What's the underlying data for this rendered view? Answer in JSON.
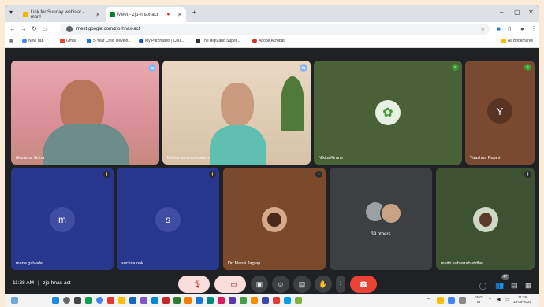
{
  "browser": {
    "tabs": [
      {
        "title": "Link for Sunday webinar - maril",
        "active": false
      },
      {
        "title": "Meet - zjo-hnax-act",
        "active": true
      }
    ],
    "url": "meet.google.com/zjo-hnax-act",
    "bookmarks": [
      "New Tab",
      "Gmail",
      "5-Year Child Develo...",
      "My Purchases | Cou...",
      "The Big6 and Super...",
      "Adobe Acrobat"
    ],
    "all_bookmarks": "All Bookmarks"
  },
  "meet": {
    "participants_row1": [
      {
        "name": "Manisha Sinha"
      },
      {
        "name": "Misha communication"
      },
      {
        "name": "Nikita Kirane"
      },
      {
        "name": "Yaashna Rajani",
        "initial": "Y"
      }
    ],
    "participants_row2": [
      {
        "name": "maria galwale",
        "initial": "m"
      },
      {
        "name": "suchita oak",
        "initial": "s"
      },
      {
        "name": "Dr. Mansi Jagtap"
      },
      {
        "name": "39 others"
      },
      {
        "name": "maitri sahasrabuddhe"
      }
    ],
    "time": "11:38 AM",
    "meeting_code": "zjo-hnax-act",
    "people_count": "47",
    "colors": {
      "accent": "#8ab4f8",
      "end_call": "#ea4335",
      "muted": "#f9dedc"
    }
  },
  "taskbar": {
    "lang": "ENG",
    "lang2": "IN",
    "clock_time": "11:38",
    "clock_date": "14-09-2025"
  }
}
